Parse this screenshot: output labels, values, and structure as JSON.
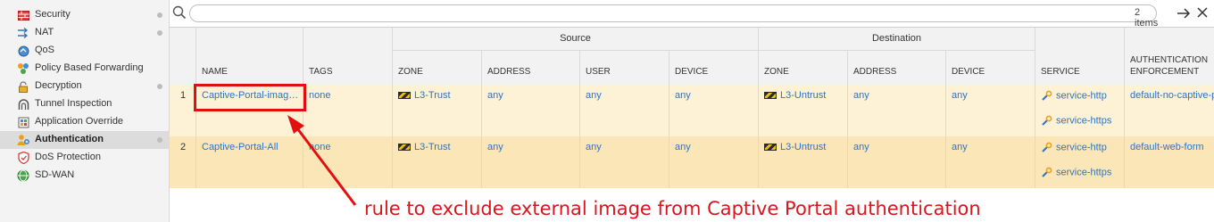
{
  "sidebar": {
    "items": [
      {
        "label": "Security",
        "icon": "security-icon",
        "dot": true
      },
      {
        "label": "NAT",
        "icon": "nat-icon",
        "dot": true
      },
      {
        "label": "QoS",
        "icon": "qos-icon",
        "dot": false
      },
      {
        "label": "Policy Based Forwarding",
        "icon": "pbf-icon",
        "dot": false
      },
      {
        "label": "Decryption",
        "icon": "lock-icon",
        "dot": true
      },
      {
        "label": "Tunnel Inspection",
        "icon": "tunnel-icon",
        "dot": false
      },
      {
        "label": "Application Override",
        "icon": "app-override-icon",
        "dot": false
      },
      {
        "label": "Authentication",
        "icon": "auth-icon",
        "dot": true,
        "active": true
      },
      {
        "label": "DoS Protection",
        "icon": "dos-icon",
        "dot": false
      },
      {
        "label": "SD-WAN",
        "icon": "sdwan-icon",
        "dot": false
      }
    ]
  },
  "search": {
    "placeholder": "",
    "count": "2 items"
  },
  "table": {
    "group_headers": {
      "source": "Source",
      "destination": "Destination"
    },
    "headers": {
      "name": "NAME",
      "tags": "TAGS",
      "src_zone": "ZONE",
      "src_address": "ADDRESS",
      "src_user": "USER",
      "src_device": "DEVICE",
      "dst_zone": "ZONE",
      "dst_address": "ADDRESS",
      "dst_device": "DEVICE",
      "service": "SERVICE",
      "auth_line1": "AUTHENTICATION",
      "auth_line2": "ENFORCEMENT"
    },
    "rows": [
      {
        "num": "1",
        "name": "Captive-Portal-imag…",
        "tags": "none",
        "src_zone": "L3-Trust",
        "src_address": "any",
        "src_user": "any",
        "src_device": "any",
        "dst_zone": "L3-Untrust",
        "dst_address": "any",
        "dst_device": "any",
        "services": [
          "service-http",
          "service-https"
        ],
        "enforcement": "default-no-captive-p"
      },
      {
        "num": "2",
        "name": "Captive-Portal-All",
        "tags": "none",
        "src_zone": "L3-Trust",
        "src_address": "any",
        "src_user": "any",
        "src_device": "any",
        "dst_zone": "L3-Untrust",
        "dst_address": "any",
        "dst_device": "any",
        "services": [
          "service-http",
          "service-https"
        ],
        "enforcement": "default-web-form"
      }
    ]
  },
  "annotation": {
    "text": "rule to exclude external image from Captive Portal authentication",
    "color": "#d8161b"
  }
}
